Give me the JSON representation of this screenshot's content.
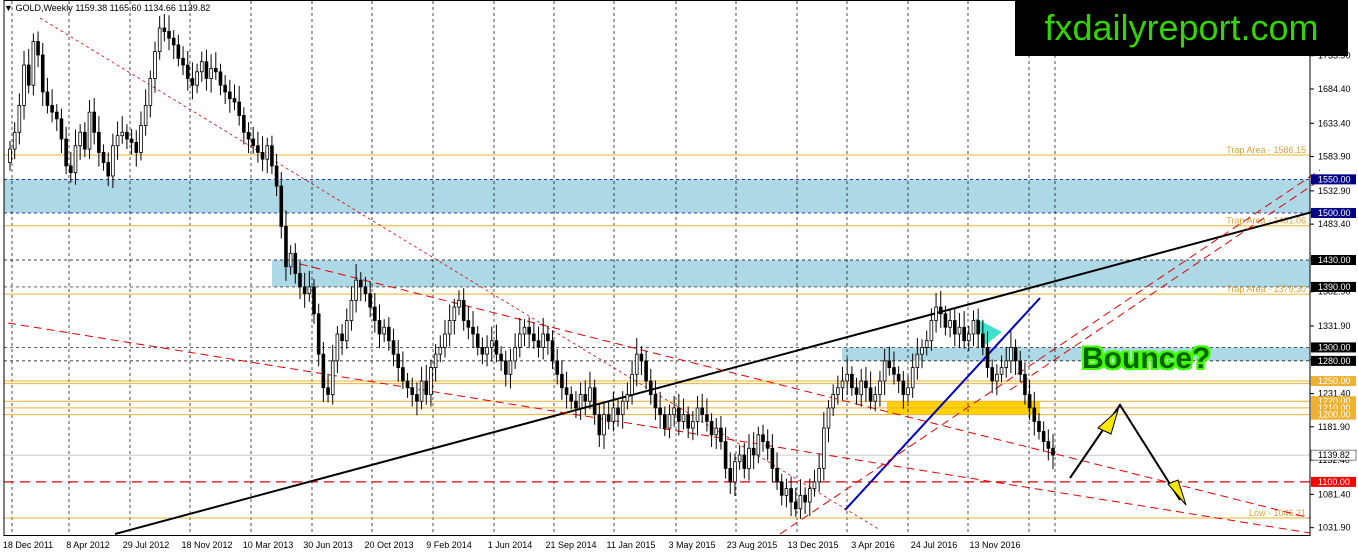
{
  "header": {
    "symbol": "GOLD,Weekly",
    "ohlc": "1159.38 1165.60 1134.66 1139.82"
  },
  "brand": "fxdailyreport.com",
  "annotation": "Bounce?",
  "colors": {
    "candle": "#000000",
    "zone": "#add8e6",
    "yellow_zone": "#ffd200",
    "trap_line": "#f0b030",
    "red_dash": "#e00000",
    "black_trend": "#000000",
    "blue_trend": "#0000c0",
    "arrow_fill": "#ffe800"
  },
  "chart_data": {
    "type": "candlestick",
    "title": "GOLD,Weekly",
    "ylim": [
      1021,
      1790
    ],
    "y_ticks": [
      "1733.90",
      "1684.40",
      "1633.40",
      "1583.90",
      "1532.90",
      "1483.40",
      "1432.40",
      "1382.90",
      "1331.90",
      "1281.40",
      "1231.40",
      "1181.90",
      "1132.40",
      "1081.40",
      "1031.90"
    ],
    "x_labels": [
      "18 Dec 2011",
      "8 Apr 2012",
      "29 Jul 2012",
      "18 Nov 2012",
      "10 Mar 2013",
      "30 Jun 2013",
      "20 Oct 2013",
      "9 Feb 2014",
      "1 Jun 2014",
      "21 Sep 2014",
      "11 Jan 2015",
      "3 May 2015",
      "23 Aug 2015",
      "13 Dec 2015",
      "3 Apr 2016",
      "24 Jul 2016",
      "13 Nov 2016"
    ],
    "level_labels": [
      {
        "value": 1550,
        "label": "1550.00"
      },
      {
        "value": 1500,
        "label": "1500.00"
      },
      {
        "value": 1430,
        "label": "1430.00"
      },
      {
        "value": 1390,
        "label": "1390.00"
      },
      {
        "value": 1300,
        "label": "1300.00"
      },
      {
        "value": 1280,
        "label": "1280.00"
      },
      {
        "value": 1250,
        "label": "1250.00"
      },
      {
        "value": 1220,
        "label": "1220.00"
      },
      {
        "value": 1210,
        "label": "1210.00"
      },
      {
        "value": 1200,
        "label": "1200.00"
      },
      {
        "value": 1139.82,
        "label": "1139.82"
      },
      {
        "value": 1100,
        "label": "1100.00"
      }
    ],
    "zones": [
      {
        "from": 1500,
        "to": 1550
      },
      {
        "from": 1390,
        "to": 1430
      },
      {
        "from": 1280,
        "to": 1300
      }
    ],
    "trap_lines": [
      {
        "value": 1586.15,
        "label": "Trap Area - 1586.15"
      },
      {
        "value": 1481.06,
        "label": "Trap Area - 1481.06"
      },
      {
        "value": 1379.3,
        "label": "Trap Area - 1379.30"
      },
      {
        "value": 1246.21,
        "label": ""
      },
      {
        "value": 1046.21,
        "label": "Low - 1046.21"
      }
    ],
    "weekly_closes": [
      1595,
      1620,
      1660,
      1720,
      1690,
      1755,
      1735,
      1680,
      1660,
      1650,
      1640,
      1610,
      1570,
      1560,
      1600,
      1620,
      1595,
      1650,
      1620,
      1590,
      1575,
      1555,
      1600,
      1615,
      1620,
      1610,
      1605,
      1590,
      1630,
      1660,
      1700,
      1740,
      1775,
      1770,
      1760,
      1750,
      1730,
      1720,
      1700,
      1690,
      1710,
      1725,
      1700,
      1715,
      1710,
      1690,
      1680,
      1670,
      1665,
      1645,
      1620,
      1610,
      1600,
      1590,
      1580,
      1600,
      1570,
      1540,
      1480,
      1420,
      1440,
      1410,
      1390,
      1380,
      1390,
      1350,
      1290,
      1240,
      1230,
      1280,
      1320,
      1310,
      1340,
      1370,
      1400,
      1390,
      1380,
      1360,
      1340,
      1320,
      1330,
      1310,
      1290,
      1270,
      1250,
      1240,
      1230,
      1220,
      1250,
      1230,
      1270,
      1290,
      1300,
      1320,
      1340,
      1360,
      1370,
      1340,
      1330,
      1320,
      1300,
      1290,
      1300,
      1310,
      1290,
      1280,
      1260,
      1280,
      1300,
      1320,
      1330,
      1320,
      1310,
      1300,
      1320,
      1310,
      1280,
      1260,
      1240,
      1230,
      1220,
      1210,
      1230,
      1220,
      1240,
      1200,
      1170,
      1200,
      1190,
      1210,
      1200,
      1220,
      1230,
      1260,
      1290,
      1280,
      1250,
      1230,
      1210,
      1200,
      1180,
      1200,
      1210,
      1190,
      1200,
      1180,
      1190,
      1210,
      1200,
      1190,
      1170,
      1180,
      1160,
      1120,
      1100,
      1130,
      1140,
      1120,
      1150,
      1140,
      1170,
      1160,
      1150,
      1120,
      1100,
      1080,
      1090,
      1070,
      1060,
      1080,
      1070,
      1090,
      1100,
      1120,
      1180,
      1210,
      1230,
      1240,
      1250,
      1260,
      1240,
      1230,
      1250,
      1240,
      1220,
      1230,
      1250,
      1280,
      1270,
      1260,
      1250,
      1230,
      1240,
      1270,
      1290,
      1300,
      1310,
      1340,
      1360,
      1350,
      1330,
      1340,
      1320,
      1330,
      1310,
      1320,
      1340,
      1320,
      1300,
      1270,
      1250,
      1260,
      1270,
      1280,
      1300,
      1280,
      1260,
      1230,
      1210,
      1190,
      1175,
      1160,
      1150,
      1139.82
    ]
  }
}
